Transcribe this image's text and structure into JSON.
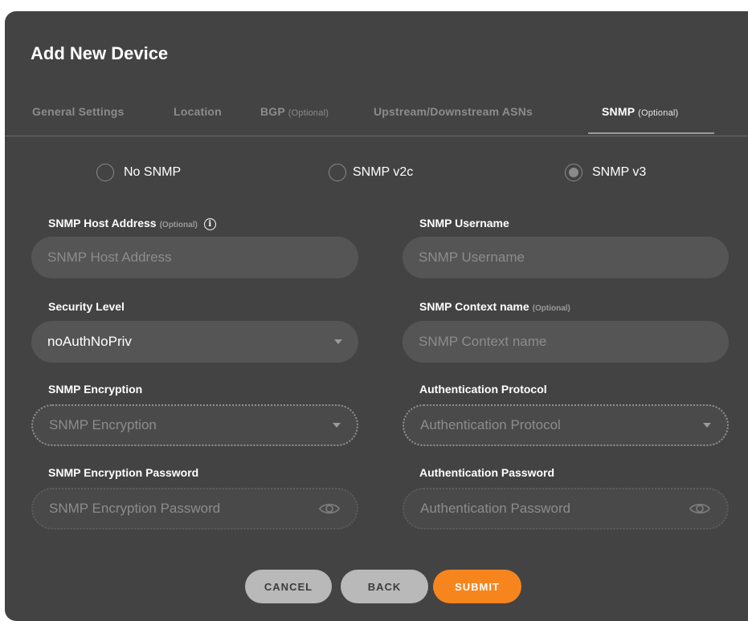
{
  "dialog": {
    "title": "Add New Device"
  },
  "tabs": [
    {
      "label": "General Settings",
      "optional": "",
      "active": false
    },
    {
      "label": "Location",
      "optional": "",
      "active": false
    },
    {
      "label": "BGP",
      "optional": "(Optional)",
      "active": false
    },
    {
      "label": "Upstream/Downstream ASNs",
      "optional": "",
      "active": false
    },
    {
      "label": "SNMP",
      "optional": "(Optional)",
      "active": true
    }
  ],
  "snmp_version": {
    "options": [
      "No SNMP",
      "SNMP v2c",
      "SNMP v3"
    ],
    "selected": "SNMP v3"
  },
  "form": {
    "host_address": {
      "label": "SNMP Host Address",
      "optional": "(Optional)",
      "placeholder": "SNMP Host Address",
      "info_icon": "i"
    },
    "username": {
      "label": "SNMP Username",
      "placeholder": "SNMP Username"
    },
    "security_level": {
      "label": "Security Level",
      "value": "noAuthNoPriv"
    },
    "context_name": {
      "label": "SNMP Context name",
      "optional": "(Optional)",
      "placeholder": "SNMP Context name"
    },
    "encryption": {
      "label": "SNMP Encryption",
      "placeholder": "SNMP Encryption"
    },
    "auth_protocol": {
      "label": "Authentication Protocol",
      "placeholder": "Authentication Protocol"
    },
    "encryption_password": {
      "label": "SNMP Encryption Password",
      "placeholder": "SNMP Encryption Password"
    },
    "auth_password": {
      "label": "Authentication Password",
      "placeholder": "Authentication Password"
    }
  },
  "buttons": {
    "cancel": "CANCEL",
    "back": "BACK",
    "submit": "SUBMIT"
  },
  "colors": {
    "background": "#434343",
    "field": "#555555",
    "accent": "#f7851e",
    "secondary_button": "#b9b9b9"
  }
}
